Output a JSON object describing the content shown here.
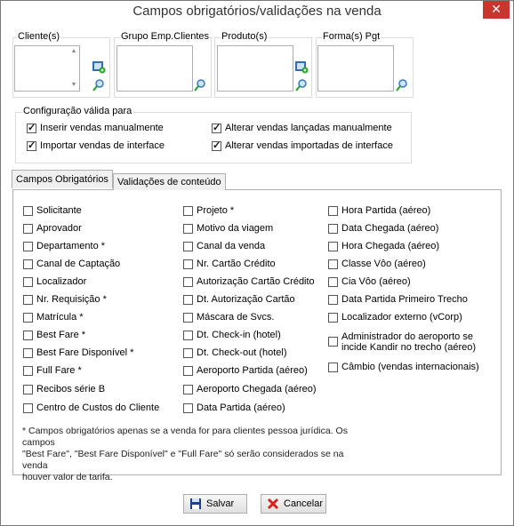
{
  "window": {
    "title": "Campos obrigatórios/validações na venda",
    "close_glyph": "✕"
  },
  "groups": [
    {
      "label": "Cliente(s)"
    },
    {
      "label": "Grupo Emp.Clientes"
    },
    {
      "label": "Produto(s)"
    },
    {
      "label": "Forma(s) Pgt"
    }
  ],
  "config": {
    "label": "Configuração válida para",
    "options": [
      {
        "label": "Inserir vendas manualmente",
        "checked": true
      },
      {
        "label": "Alterar vendas lançadas manualmente",
        "checked": true
      },
      {
        "label": "Importar vendas de interface",
        "checked": true
      },
      {
        "label": "Alterar vendas importadas de interface",
        "checked": true
      }
    ]
  },
  "tabs": [
    {
      "label": "Campos Obrigatórios",
      "active": true
    },
    {
      "label": "Validações de conteúdo",
      "active": false
    }
  ],
  "fields": {
    "col1": [
      "Solicitante",
      "Aprovador",
      "Departamento *",
      "Canal de Captação",
      "Localizador",
      "Nr. Requisição *",
      "Matrícula *",
      "Best Fare *",
      "Best Fare Disponível *",
      "Full Fare *",
      "Recibos série B",
      "Centro de Custos do Cliente"
    ],
    "col2": [
      "Projeto *",
      "Motivo da viagem",
      "Canal da venda",
      "Nr. Cartão Crédito",
      "Autorização Cartão Crédito",
      "Dt. Autorização Cartão",
      "Máscara de Svcs.",
      "Dt. Check-in (hotel)",
      "Dt. Check-out (hotel)",
      "Aeroporto Partida (aéreo)",
      "Aeroporto Chegada (aéreo)",
      "Data Partida (aéreo)"
    ],
    "col3": [
      "Hora Partida (aéreo)",
      "Data Chegada (aéreo)",
      "Hora Chegada (aéreo)",
      "Classe Vôo (aéreo)",
      "Cia Vôo (aéreo)",
      "Data Partida Primeiro Trecho",
      "Localizador externo (vCorp)"
    ],
    "col3_multiline_line1": "Administrador do aeroporto se",
    "col3_multiline_line2": "incide Kandir no trecho (aéreo)",
    "col3_last": "Câmbio (vendas internacionais)"
  },
  "note": {
    "line1": "* Campos obrigatórios apenas se a venda for para clientes pessoa jurídica. Os campos",
    "line2": "\"Best Fare\", \"Best Fare Disponível\" e \"Full Fare\" só serão considerados se na venda",
    "line3": "houver valor de tarifa."
  },
  "buttons": {
    "save": "Salvar",
    "cancel": "Cancelar"
  },
  "icons": {
    "close": "close-icon",
    "add": "add-icon",
    "search": "search-icon",
    "save": "floppy-icon",
    "cancel": "cancel-x-icon"
  },
  "colors": {
    "highlight": "#e0191f",
    "close_bg": "#c7372f"
  }
}
